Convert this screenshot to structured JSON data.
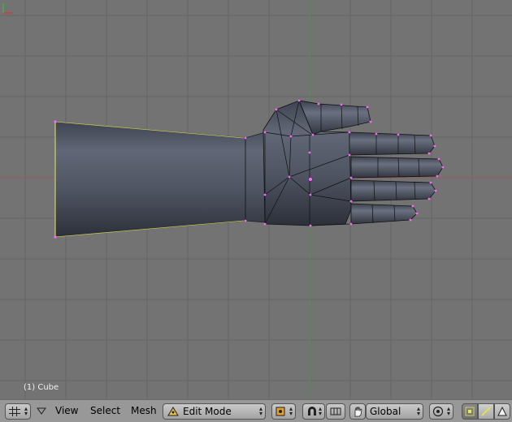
{
  "viewport": {
    "object_label": "(1) Cube",
    "background_color": "#737373",
    "grid_color": "#656565",
    "x_axis_color": "#9a5b5b",
    "y_axis_color": "#4f8f4f",
    "mesh_color": "#5a6070",
    "vertex_color": "#ff66ff"
  },
  "header": {
    "editor_type_icon": "grid-icon",
    "menus": {
      "view": "View",
      "select": "Select",
      "mesh": "Mesh"
    },
    "mode_selector": {
      "label": "Edit Mode",
      "icon": "mode-triangle-icon"
    },
    "pivot_icon": "pivot-icon",
    "snap_icon": "magnet-icon",
    "snap_element_icon": "snap-grid-icon",
    "manipulator_icon": "hand-icon",
    "orientation": {
      "label": "Global"
    },
    "proportional_icon": "proportional-edit-icon",
    "select_modes": [
      "vertex-select-icon",
      "edge-select-icon",
      "face-select-icon"
    ]
  }
}
